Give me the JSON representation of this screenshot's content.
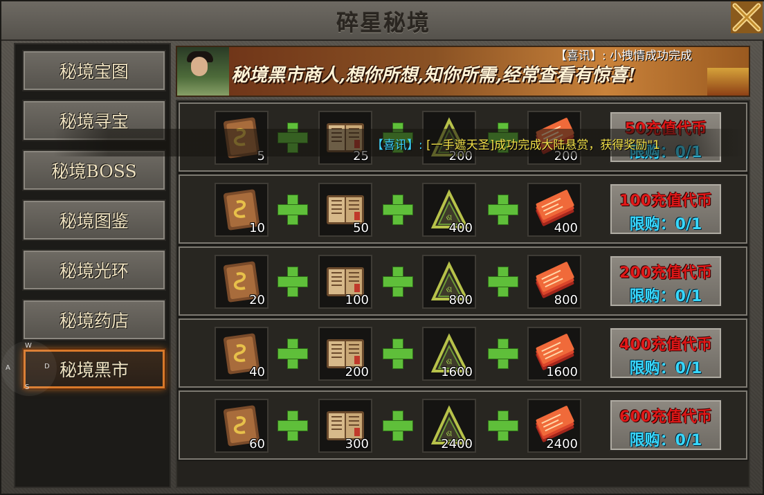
{
  "window": {
    "title": "碎星秘境"
  },
  "sidebar": {
    "items": [
      {
        "label": "秘境宝图"
      },
      {
        "label": "秘境寻宝"
      },
      {
        "label": "秘境BOSS"
      },
      {
        "label": "秘境图鉴"
      },
      {
        "label": "秘境光环"
      },
      {
        "label": "秘境药店"
      },
      {
        "label": "秘境黑市",
        "active": true
      }
    ]
  },
  "overlay": {
    "keys": [
      "W",
      "A",
      "S",
      "D"
    ]
  },
  "banner": {
    "slogan": "秘境黑市商人,想你所想,知你所需,经常查看有惊喜!",
    "news": "【喜讯】: 小拽情成功完成"
  },
  "ticker": {
    "tag": "【喜讯】:",
    "body": "[一手遮天圣]成功完成大陆悬赏，获得奖励\"1"
  },
  "item_icons": [
    "scroll-icon",
    "book-icon",
    "triangle-rune-icon",
    "red-ticket-icon"
  ],
  "colors": {
    "price": "#e01818",
    "limit": "#38d8ff",
    "plus": "#5fbf3a",
    "active_tab_glow": "#d9792a"
  },
  "offers": [
    {
      "quantities": [
        "5",
        "25",
        "200",
        "200"
      ],
      "price": "50充值代币",
      "limit": "限购：0/1"
    },
    {
      "quantities": [
        "10",
        "50",
        "400",
        "400"
      ],
      "price": "100充值代币",
      "limit": "限购：0/1"
    },
    {
      "quantities": [
        "20",
        "100",
        "800",
        "800"
      ],
      "price": "200充值代币",
      "limit": "限购：0/1"
    },
    {
      "quantities": [
        "40",
        "200",
        "1600",
        "1600"
      ],
      "price": "400充值代币",
      "limit": "限购：0/1"
    },
    {
      "quantities": [
        "60",
        "300",
        "2400",
        "2400"
      ],
      "price": "600充值代币",
      "limit": "限购：0/1"
    }
  ]
}
